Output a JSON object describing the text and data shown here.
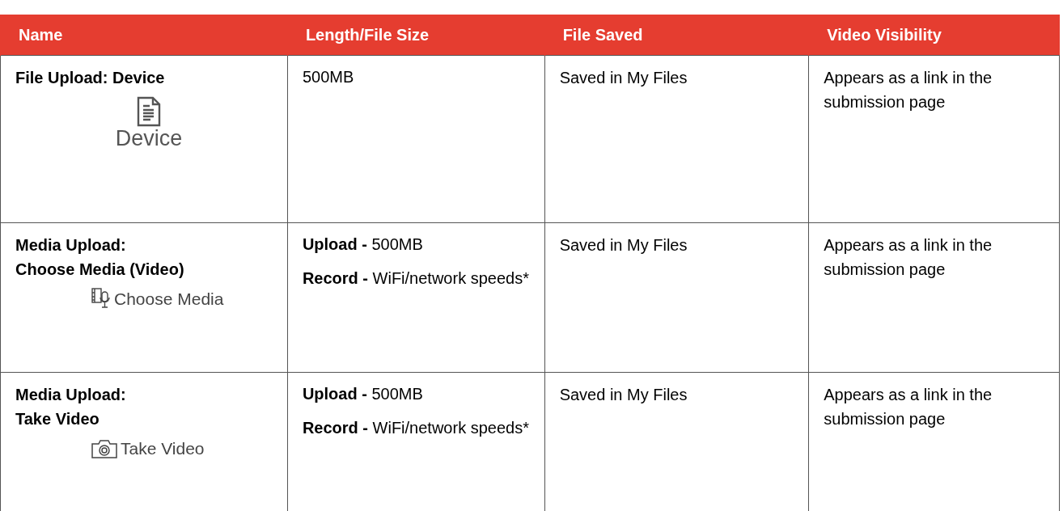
{
  "table": {
    "columns": [
      "Name",
      "Length/File Size",
      "File Saved",
      "Video Visibility"
    ],
    "rows": [
      {
        "name": [
          "File Upload: Device"
        ],
        "tool": {
          "kind": "document",
          "label": "Device"
        },
        "size": [
          "500MB"
        ],
        "saved": "Saved in My Files",
        "visibility": "Appears as a link in the submission page"
      },
      {
        "name": [
          "Media Upload:",
          "Choose Media (Video)"
        ],
        "tool": {
          "kind": "media",
          "label": "Choose Media"
        },
        "size": [
          "**Upload -** 500MB",
          "**Record -** WiFi/network speeds*"
        ],
        "saved": "Saved in My Files",
        "visibility": "Appears as a link in the submission page"
      },
      {
        "name": [
          "Media Upload:",
          "Take Video"
        ],
        "tool": {
          "kind": "camera",
          "label": "Take Video"
        },
        "size": [
          "**Upload -** 500MB",
          "**Record -** WiFi/network speeds*"
        ],
        "saved": "Saved in My Files",
        "visibility": "Appears as a link in the submission page"
      }
    ]
  }
}
